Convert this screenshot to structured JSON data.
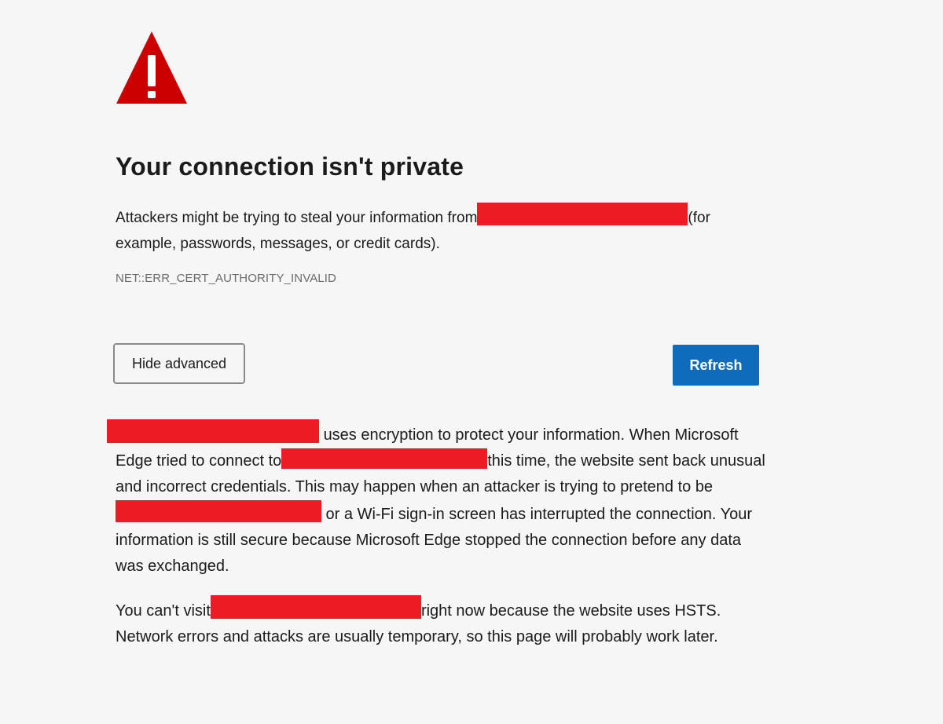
{
  "icon": {
    "name": "warning-triangle-icon",
    "color": "#cc0000"
  },
  "title": "Your connection isn't private",
  "summary": {
    "before": "Attackers might be trying to steal your information from",
    "after": "(for example, passwords, messages, or credit cards)."
  },
  "error_code": "NET::ERR_CERT_AUTHORITY_INVALID",
  "buttons": {
    "hide_advanced": "Hide advanced",
    "refresh": "Refresh"
  },
  "details": {
    "part1": "uses encryption to protect your information. When Microsoft Edge tried to connect to",
    "part2": "this time, the website sent back unusual and incorrect credentials. This may happen when an attacker is trying to pretend to be",
    "part3": " or a Wi-Fi sign-in screen has interrupted the connection. Your information is still secure because Microsoft Edge stopped the connection before any data was exchanged."
  },
  "hsts": {
    "before": "You can't visit",
    "after": "right now because the website uses HSTS. Network errors and attacks are usually temporary, so this page will probably work later."
  },
  "colors": {
    "redaction": "#ec1c24",
    "refresh_button": "#0f6cbd",
    "background": "#f6f6f6"
  }
}
